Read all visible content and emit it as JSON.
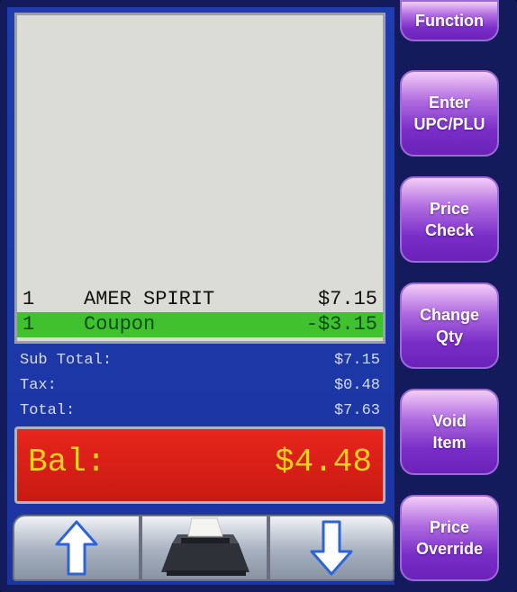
{
  "receipt": {
    "lines": [
      {
        "qty": "1",
        "desc": "AMER SPIRIT",
        "amount": "$7.15",
        "selected": false
      },
      {
        "qty": "1",
        "desc": "Coupon",
        "amount": "-$3.15",
        "selected": true
      }
    ]
  },
  "totals": {
    "subtotal_label": "Sub Total:",
    "subtotal_value": "$7.15",
    "tax_label": "Tax:",
    "tax_value": "$0.48",
    "total_label": "Total:",
    "total_value": "$7.63"
  },
  "balance": {
    "label": "Bal:",
    "value": "$4.48"
  },
  "function_buttons": [
    {
      "line1": "Function",
      "line2": ""
    },
    {
      "line1": "Enter",
      "line2": "UPC/PLU"
    },
    {
      "line1": "Price",
      "line2": "Check"
    },
    {
      "line1": "Change",
      "line2": "Qty"
    },
    {
      "line1": "Void",
      "line2": "Item"
    },
    {
      "line1": "Price",
      "line2": "Override"
    }
  ],
  "nav": {
    "up_icon": "arrow-up-icon",
    "printer_icon": "receipt-printer-icon",
    "down_icon": "arrow-down-icon"
  },
  "colors": {
    "panel_blue": "#1f3db0",
    "selected_green": "#3fc22e",
    "balance_red": "#e8251c",
    "balance_text": "#f4d21c",
    "button_purple": "#7a2ec8"
  }
}
